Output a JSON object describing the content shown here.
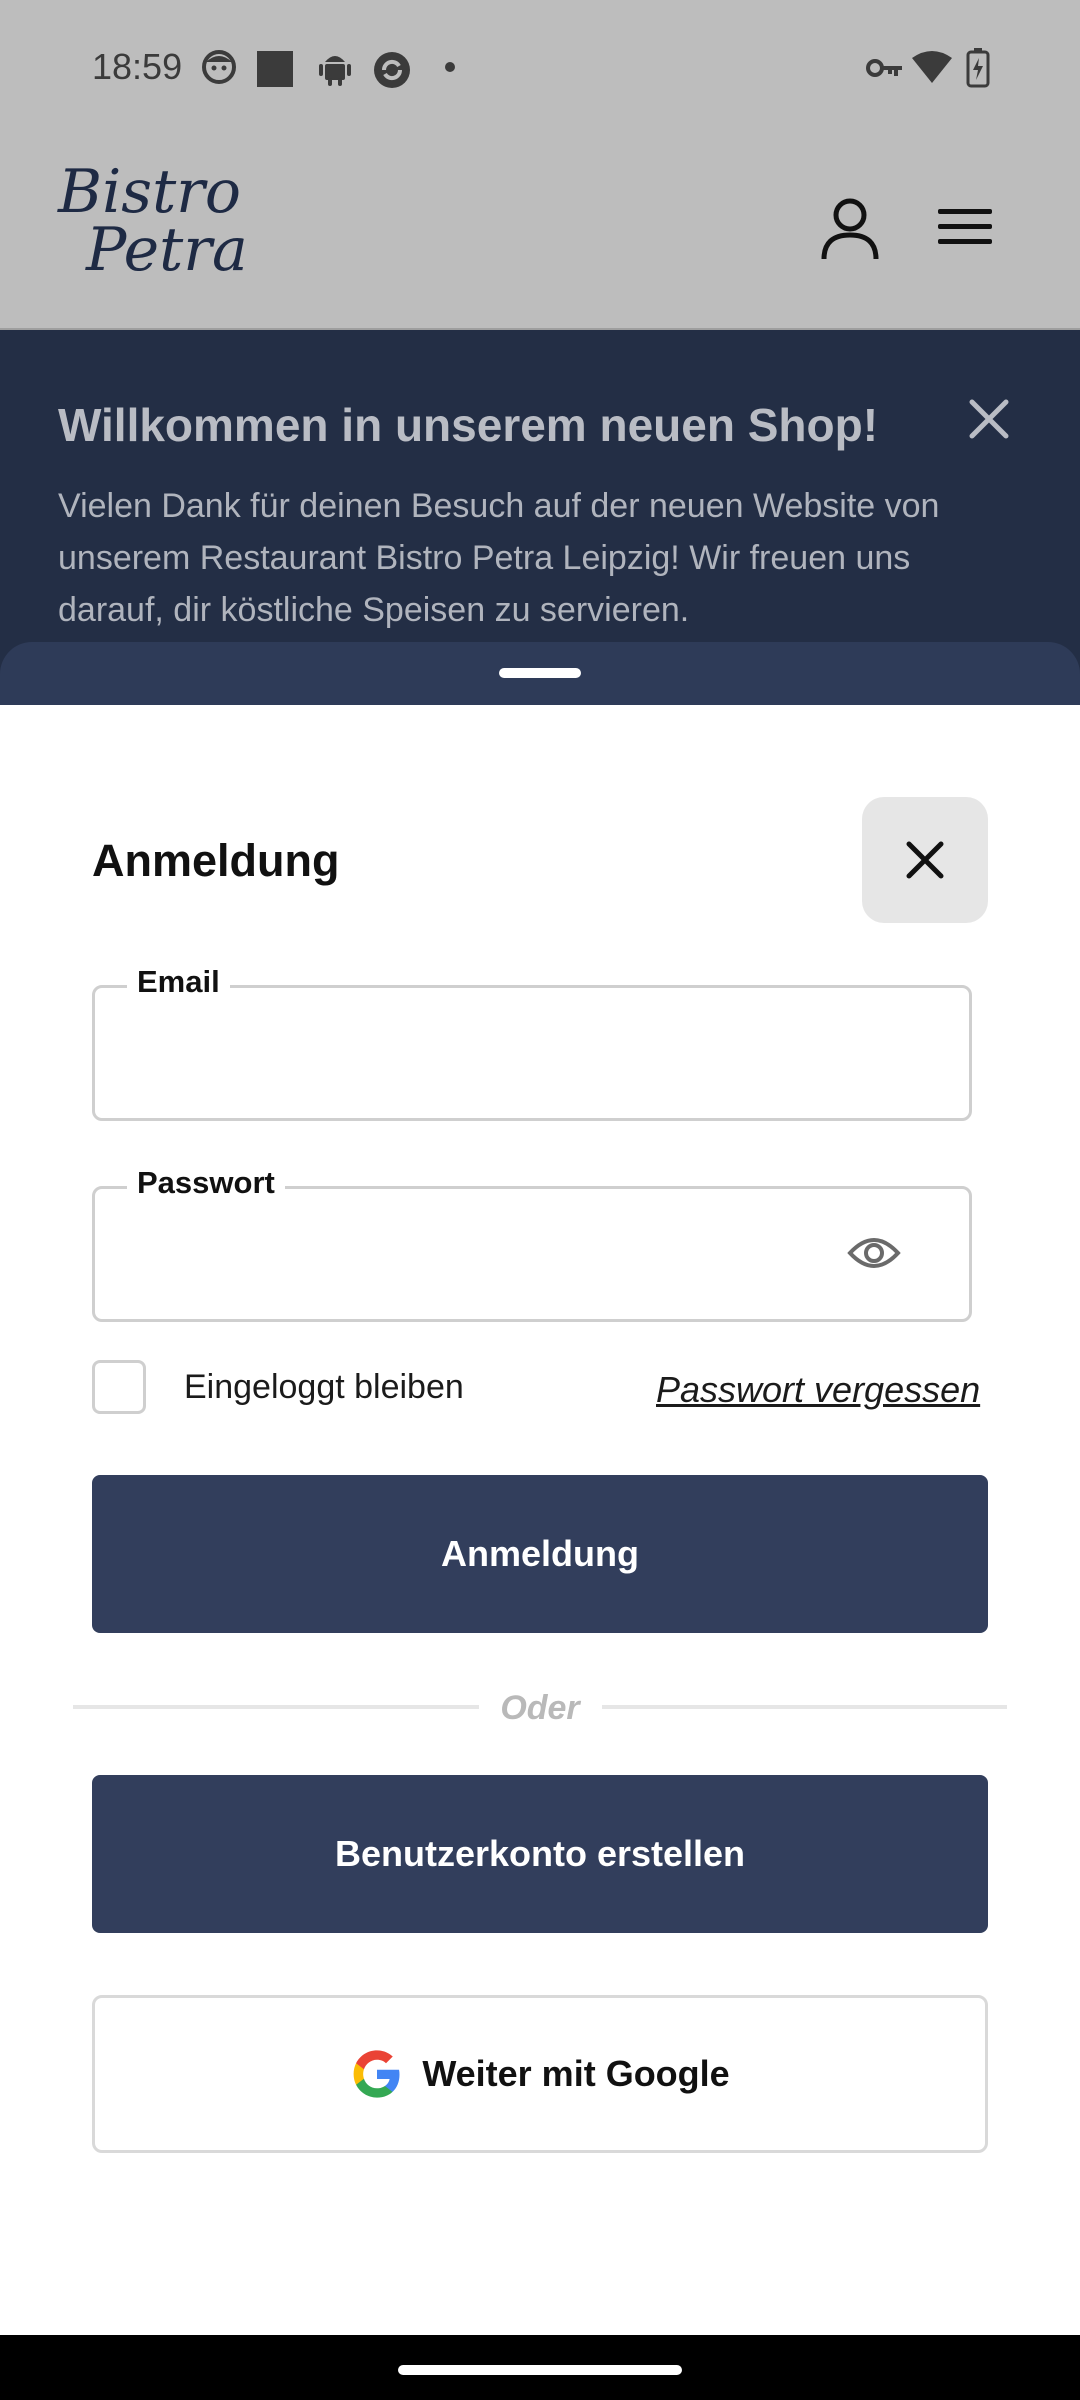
{
  "status_bar": {
    "time": "18:59",
    "icons_left": [
      "face-icon",
      "square-icon",
      "android-icon",
      "sync-icon",
      "dot-icon"
    ],
    "icons_right": [
      "key-icon",
      "wifi-icon",
      "battery-charging-icon"
    ]
  },
  "header": {
    "logo_line1": "Bistro",
    "logo_line2": "Petra",
    "icons": [
      "user-icon",
      "menu-icon"
    ]
  },
  "banner": {
    "title": "Willkommen in unserem neuen Shop!",
    "text": "Vielen Dank für deinen Besuch auf der neuen Website von unserem Restaurant Bistro Petra Leipzig! Wir freuen uns darauf, dir köstliche Speisen zu servieren."
  },
  "login": {
    "title": "Anmeldung",
    "email_label": "Email",
    "email_value": "",
    "password_label": "Passwort",
    "password_value": "",
    "remember_label": "Eingeloggt bleiben",
    "remember_checked": false,
    "forgot_link": "Passwort vergessen",
    "submit_label": "Anmeldung",
    "divider_text": "Oder",
    "register_label": "Benutzerkonto erstellen",
    "google_label": "Weiter mit Google"
  },
  "colors": {
    "primary_dark": "#323e5c",
    "banner_bg": "#232e45",
    "header_bg": "#bdbdbd"
  }
}
